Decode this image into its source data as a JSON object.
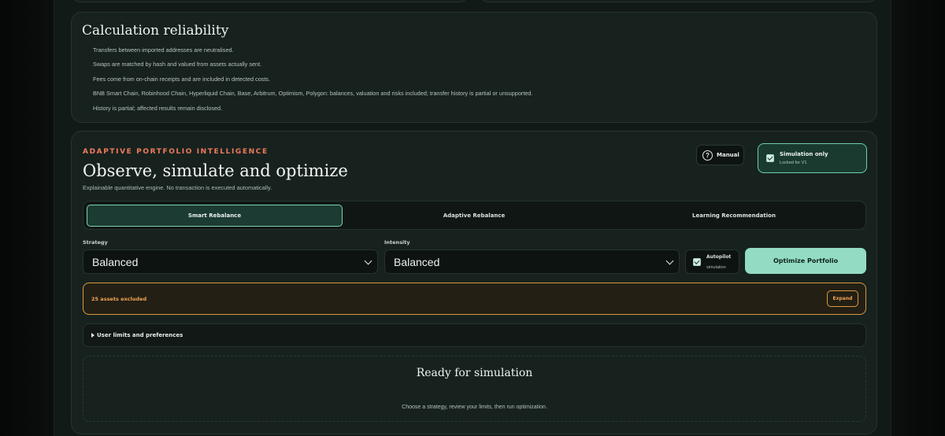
{
  "reliability": {
    "title": "Calculation reliability",
    "items": [
      "Transfers between imported addresses are neutralised.",
      "Swaps are matched by hash and valued from assets actually sent.",
      "Fees come from on-chain receipts and are included in detected costs.",
      "BNB Smart Chain, Robinhood Chain, Hyperliquid Chain, Base, Arbitrum, Optimism, Polygon: balances, valuation and risks included; transfer history is partial or unsupported.",
      "History is partial; affected results remain disclosed."
    ]
  },
  "engine": {
    "eyebrow": "ADAPTIVE PORTFOLIO INTELLIGENCE",
    "title": "Observe, simulate and optimize",
    "subtitle": "Explainable quantitative engine. No transaction is executed automatically.",
    "manual_label": "Manual",
    "simulation": {
      "title": "Simulation only",
      "subtitle": "Locked for V1",
      "checked": true
    },
    "tabs": [
      {
        "label": "Smart Rebalance",
        "active": true
      },
      {
        "label": "Adaptive Rebalance",
        "active": false
      },
      {
        "label": "Learning Recommendation",
        "active": false
      }
    ],
    "strategy": {
      "label": "Strategy",
      "value": "Balanced"
    },
    "intensity": {
      "label": "Intensity",
      "value": "Balanced"
    },
    "autopilot": {
      "title": "Autopilot",
      "subtitle": "simulation",
      "checked": true
    },
    "optimize_label": "Optimize Portfolio",
    "excluded": {
      "text": "25 assets excluded",
      "expand_label": "Expand"
    },
    "limits_label": "User limits and preferences",
    "ready": {
      "title": "Ready for simulation",
      "hint": "Choose a strategy, review your limits, then run optimization."
    }
  },
  "colors": {
    "accent": "#93dcc3",
    "eyebrow": "#f07a5c",
    "warning": "#f0a457",
    "background": "#121a17"
  },
  "icons": [
    "question-circle-icon",
    "checkbox-checked-icon",
    "chevron-down-icon",
    "disclosure-triangle-icon"
  ]
}
